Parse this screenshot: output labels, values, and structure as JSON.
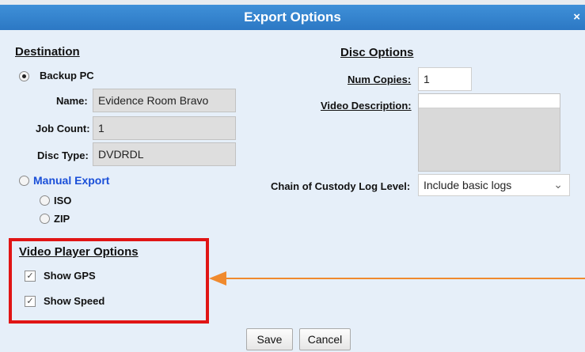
{
  "title": "Export Options",
  "close_glyph": "×",
  "destination": {
    "heading": "Destination",
    "backup_pc_label": "Backup PC",
    "name_label": "Name:",
    "name_value": "Evidence Room Bravo",
    "job_count_label": "Job Count:",
    "job_count_value": "1",
    "disc_type_label": "Disc Type:",
    "disc_type_value": "DVDRDL",
    "manual_export_label": "Manual Export",
    "iso_label": "ISO",
    "zip_label": "ZIP"
  },
  "disc_options": {
    "heading": "Disc Options",
    "num_copies_label": "Num Copies:",
    "num_copies_value": "1",
    "video_description_label": "Video Description:",
    "video_description_value": "",
    "chain_label": "Chain of Custody Log Level:",
    "chain_value": "Include basic logs"
  },
  "video_player": {
    "heading": "Video Player Options",
    "show_gps_label": "Show GPS",
    "show_speed_label": "Show Speed"
  },
  "buttons": {
    "save": "Save",
    "cancel": "Cancel"
  },
  "colors": {
    "title_bar": "#2c78c4",
    "highlight_box": "#e01515",
    "arrow": "#f08a2e",
    "link": "#1a4fd8"
  }
}
